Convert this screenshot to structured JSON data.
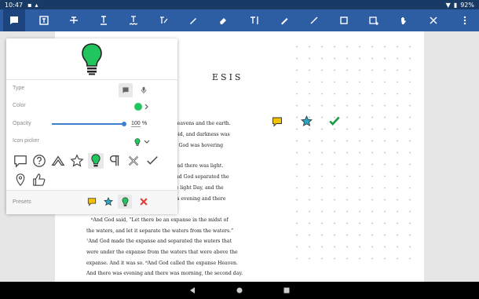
{
  "statusbar": {
    "time": "10:47",
    "battery": "92%"
  },
  "toolbar": {
    "tools": [
      "comment-tool-icon",
      "text-box-icon",
      "strikeout-icon",
      "underline-icon",
      "squiggly-icon",
      "free-text-icon",
      "pen-icon",
      "eraser-icon",
      "text-cursor-icon",
      "highlighter-icon",
      "line-icon",
      "square-icon",
      "add-shape-icon",
      "hand-icon",
      "close-icon",
      "more-icon"
    ]
  },
  "panel": {
    "type_label": "Type",
    "color_label": "Color",
    "color_value": "#21c55d",
    "opacity_label": "Opacity",
    "opacity_value": "100",
    "opacity_unit": "%",
    "opacity_level": 1.0,
    "icon_picker_label": "Icon picker",
    "icons": [
      "comment",
      "help",
      "up",
      "star",
      "lightbulb",
      "paragraph",
      "cross",
      "check",
      "pin",
      "thumbs-up"
    ],
    "presets_label": "Presets",
    "presets": [
      "comment",
      "star",
      "lightbulb",
      "cross"
    ]
  },
  "document": {
    "chapter_title": "ESIS",
    "lines": [
      "ed the heavens and the earth.",
      "n and void, and darkness was",
      "Spirit of God was hovering",
      "light,” and there was light.",
      "good. And God separated the",
      "alled the light Day, and the",
      "here was evening and there",
      "⁶And God said, “Let there be an expanse in the midst of",
      "the waters, and let it separate the waters from the waters.”",
      "⁷And God made the expanse and separated the waters that",
      "were under the expanse from the waters that were above the",
      "expanse. And it was so. ⁸And God called the expanse Heaven.",
      "And there was evening and there was morning, the second day."
    ]
  },
  "colors": {
    "toolbar": "#2d5da3",
    "statusbar": "#1a3a66",
    "green": "#21c55d",
    "teal": "#2ba6c4",
    "yellow": "#f2c200",
    "red": "#e53935"
  }
}
